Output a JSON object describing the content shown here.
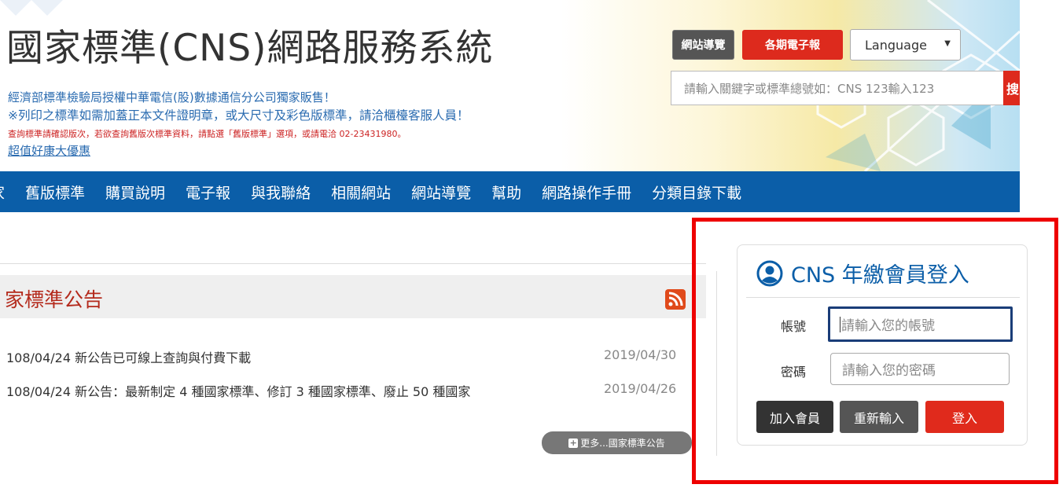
{
  "header": {
    "site_title": "國家標準(CNS)網路服務系統",
    "tagline1": "經濟部標準檢驗局授權中華電信(股)數據通信分公司獨家販售！",
    "tagline2": "※列印之標準如需加蓋正本文件證明章，或大尺寸及彩色版標準，請洽櫃檯客服人員！",
    "tagline3": "查詢標準請確認版次，若欲查詢舊版次標準資料，請點選「舊版標準」選項，或請電洽 02-23431980。",
    "promo_link": "超值好康大優惠",
    "sitemap_button": "網站導覽",
    "newsletter_button": "各期電子報",
    "language_select": "Language",
    "search_placeholder": "請輸入關鍵字或標準總號如：CNS 123輸入123",
    "search_button": "搜"
  },
  "nav": {
    "items": [
      "家",
      "舊版標準",
      "購買說明",
      "電子報",
      "與我聯絡",
      "相關網站",
      "網站導覽",
      "幫助",
      "網路操作手冊",
      "分類目錄下載"
    ]
  },
  "announcements": {
    "title": "家標準公告",
    "rows": [
      {
        "text": "108/04/24 新公告已可線上查詢與付費下載",
        "date": "2019/04/30"
      },
      {
        "text": "108/04/24 新公告：最新制定 4 種國家標準、修訂 3 種國家標準、廢止 50 種國家",
        "date": "2019/04/26"
      }
    ],
    "more_button": "更多...國家標準公告"
  },
  "login": {
    "title": "CNS 年繳會員登入",
    "account_label": "帳號",
    "account_placeholder": "請輸入您的帳號",
    "password_label": "密碼",
    "password_placeholder": "請輸入您的密碼",
    "join_button": "加入會員",
    "reset_button": "重新輸入",
    "login_button": "登入"
  },
  "colors": {
    "nav_blue": "#0b5ea8",
    "accent_red": "#dd2a1d",
    "highlight_red": "#ee0000",
    "title_red": "#b42a1c"
  }
}
